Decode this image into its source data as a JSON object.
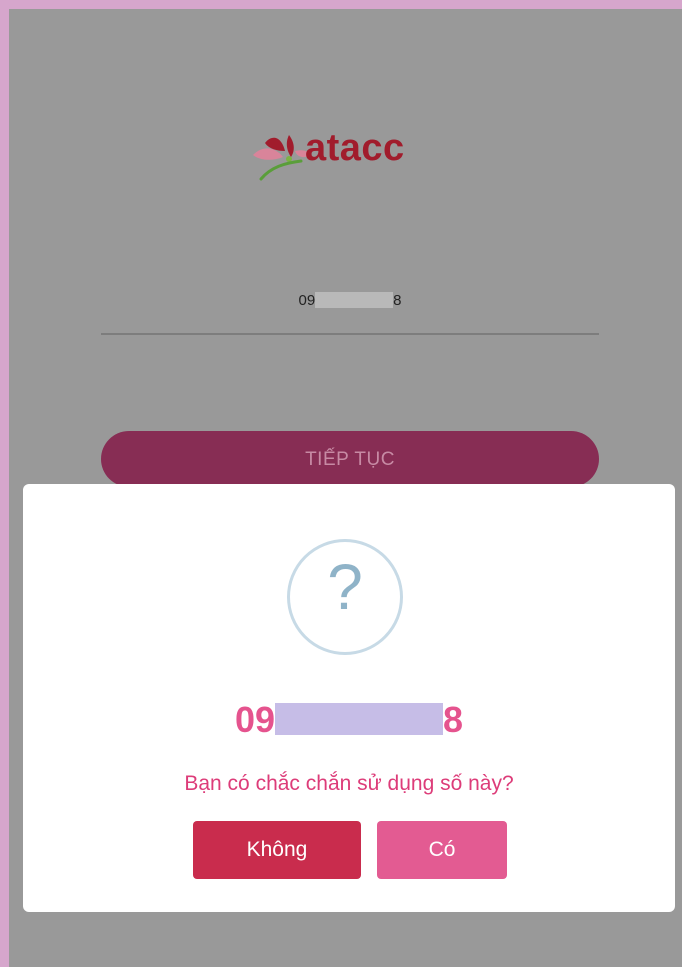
{
  "logo": {
    "text": "atacc"
  },
  "phone_field": {
    "value_prefix": "09",
    "value_suffix": "8"
  },
  "continue_button": {
    "label": "TIẾP TỤC"
  },
  "dialog": {
    "icon": "question-icon",
    "number_prefix": "09",
    "number_suffix": "8",
    "message": "Bạn có chắc chắn sử dụng số này?",
    "no_button": "Không",
    "yes_button": "Có"
  },
  "colors": {
    "overlay": "#999999",
    "accent_pink": "#e5538e",
    "no_button": "#c92c4d",
    "yes_button": "#e35b92",
    "continue_button": "#872d54",
    "logo_red": "#a11c2c"
  }
}
